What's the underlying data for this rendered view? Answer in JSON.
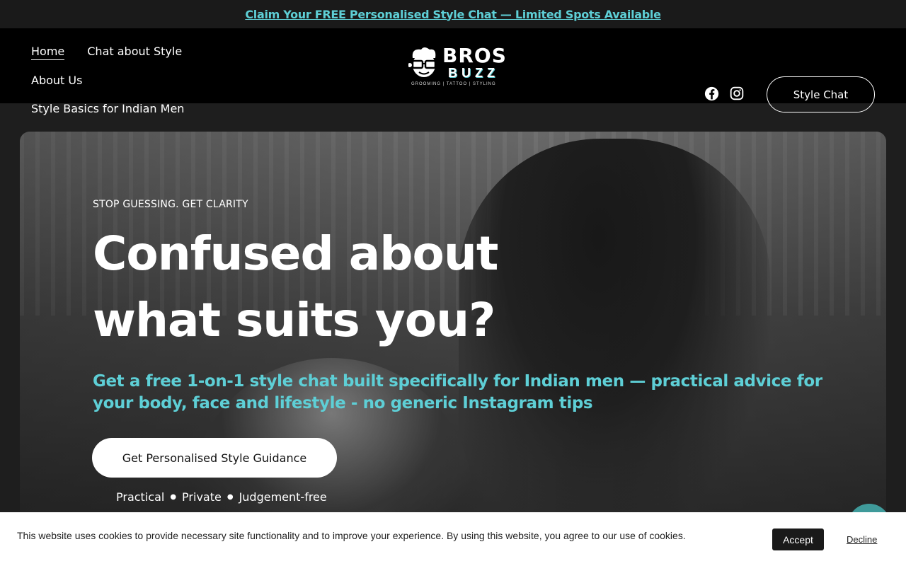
{
  "announcement": {
    "text": "Claim Your FREE Personalised Style Chat — Limited Spots Available"
  },
  "nav": {
    "items": [
      {
        "label": "Home",
        "active": true
      },
      {
        "label": "Chat about Style"
      },
      {
        "label": "About Us"
      },
      {
        "label": "Style Basics for Indian Men"
      }
    ]
  },
  "logo": {
    "line1": "BROS",
    "line2": "BUZZ",
    "tagline": "GROOMING | TATTOO | STYLING"
  },
  "social": {
    "facebook_icon": "facebook-icon",
    "instagram_icon": "instagram-icon"
  },
  "header_cta": {
    "label": "Style Chat"
  },
  "hero": {
    "eyebrow": "STOP GUESSING. GET CLARITY",
    "headline_line1": "Confused about",
    "headline_line2": "what suits you?",
    "subheading": "Get a free 1-on-1 style chat built specifically for Indian men — practical advice for your body, face and lifestyle - no generic Instagram tips",
    "cta_label": "Get Personalised Style Guidance",
    "tags": [
      "Practical",
      "Private",
      "Judgement-free"
    ]
  },
  "cookie": {
    "text": "This website uses cookies to provide necessary site functionality and to improve your experience. By using this website, you agree to our use of cookies.",
    "accept": "Accept",
    "decline": "Decline"
  },
  "colors": {
    "accent": "#5ecfd6",
    "header_bg": "#000000",
    "page_bg": "#1e1e1e"
  }
}
